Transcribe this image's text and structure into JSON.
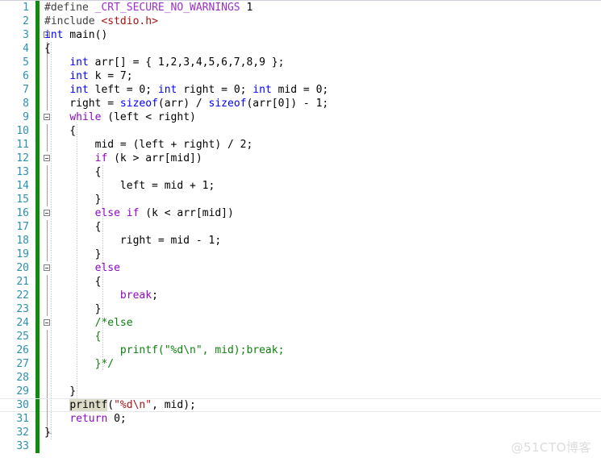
{
  "editor": {
    "language": "c",
    "total_lines": 33,
    "current_line": 30,
    "colors": {
      "background": "#ffffff",
      "line_number": "#2b91af",
      "change_bar": "#108b10",
      "keyword": "#0000ff",
      "control_keyword": "#8f08c4",
      "comment": "#108010",
      "string": "#a31515",
      "macro": "#9b30c9",
      "preprocessor": "#404040",
      "highlight": "#dbdbc8",
      "indent_guide": "#c8c8c8"
    }
  },
  "lines": [
    {
      "n": "1",
      "text": "#define _CRT_SECURE_NO_WARNINGS 1"
    },
    {
      "n": "2",
      "text": "#include <stdio.h>"
    },
    {
      "n": "3",
      "text": "int main()"
    },
    {
      "n": "4",
      "text": "{"
    },
    {
      "n": "5",
      "text": "    int arr[] = { 1,2,3,4,5,6,7,8,9 };"
    },
    {
      "n": "6",
      "text": "    int k = 7;"
    },
    {
      "n": "7",
      "text": "    int left = 0; int right = 0; int mid = 0;"
    },
    {
      "n": "8",
      "text": "    right = sizeof(arr) / sizeof(arr[0]) - 1;"
    },
    {
      "n": "9",
      "text": "    while (left < right)"
    },
    {
      "n": "10",
      "text": "    {"
    },
    {
      "n": "11",
      "text": "        mid = (left + right) / 2;"
    },
    {
      "n": "12",
      "text": "        if (k > arr[mid])"
    },
    {
      "n": "13",
      "text": "        {"
    },
    {
      "n": "14",
      "text": "            left = mid + 1;"
    },
    {
      "n": "15",
      "text": "        }"
    },
    {
      "n": "16",
      "text": "        else if (k < arr[mid])"
    },
    {
      "n": "17",
      "text": "        {"
    },
    {
      "n": "18",
      "text": "            right = mid - 1;"
    },
    {
      "n": "19",
      "text": "        }"
    },
    {
      "n": "20",
      "text": "        else"
    },
    {
      "n": "21",
      "text": "        {"
    },
    {
      "n": "22",
      "text": "            break;"
    },
    {
      "n": "23",
      "text": "        }"
    },
    {
      "n": "24",
      "text": "        /*else"
    },
    {
      "n": "25",
      "text": "        {"
    },
    {
      "n": "26",
      "text": "            printf(\"%d\\n\", mid);break;"
    },
    {
      "n": "27",
      "text": "        }*/"
    },
    {
      "n": "28",
      "text": ""
    },
    {
      "n": "29",
      "text": "    }"
    },
    {
      "n": "30",
      "text": "    printf(\"%d\\n\", mid);"
    },
    {
      "n": "31",
      "text": "    return 0;"
    },
    {
      "n": "32",
      "text": "}"
    },
    {
      "n": "33",
      "text": ""
    }
  ],
  "tokens": {
    "l1": [
      {
        "t": "#define ",
        "c": "pp"
      },
      {
        "t": "_CRT_SECURE_NO_WARNINGS",
        "c": "mac"
      },
      {
        "t": " 1",
        "c": "pl"
      }
    ],
    "l2": [
      {
        "t": "#include ",
        "c": "pp"
      },
      {
        "t": "<stdio.h>",
        "c": "inc"
      }
    ],
    "l3": [
      {
        "t": "int",
        "c": "k"
      },
      {
        "t": " main()",
        "c": "pl"
      }
    ],
    "l4": [
      {
        "t": "{",
        "c": "pl"
      }
    ],
    "l5": [
      {
        "t": "    ",
        "c": "pl"
      },
      {
        "t": "int",
        "c": "k"
      },
      {
        "t": " arr[] = { 1,2,3,4,5,6,7,8,9 };",
        "c": "pl"
      }
    ],
    "l6": [
      {
        "t": "    ",
        "c": "pl"
      },
      {
        "t": "int",
        "c": "k"
      },
      {
        "t": " k = 7;",
        "c": "pl"
      }
    ],
    "l7": [
      {
        "t": "    ",
        "c": "pl"
      },
      {
        "t": "int",
        "c": "k"
      },
      {
        "t": " left = 0; ",
        "c": "pl"
      },
      {
        "t": "int",
        "c": "k"
      },
      {
        "t": " right = 0; ",
        "c": "pl"
      },
      {
        "t": "int",
        "c": "k"
      },
      {
        "t": " mid = 0;",
        "c": "pl"
      }
    ],
    "l8": [
      {
        "t": "    right = ",
        "c": "pl"
      },
      {
        "t": "sizeof",
        "c": "k"
      },
      {
        "t": "(arr) / ",
        "c": "pl"
      },
      {
        "t": "sizeof",
        "c": "k"
      },
      {
        "t": "(arr[0]) - 1;",
        "c": "pl"
      }
    ],
    "l9": [
      {
        "t": "    ",
        "c": "pl"
      },
      {
        "t": "while",
        "c": "kc"
      },
      {
        "t": " (left < right)",
        "c": "pl"
      }
    ],
    "l10": [
      {
        "t": "    {",
        "c": "pl"
      }
    ],
    "l11": [
      {
        "t": "        mid = (left + right) / 2;",
        "c": "pl"
      }
    ],
    "l12": [
      {
        "t": "        ",
        "c": "pl"
      },
      {
        "t": "if",
        "c": "kc"
      },
      {
        "t": " (k > arr[mid])",
        "c": "pl"
      }
    ],
    "l13": [
      {
        "t": "        {",
        "c": "pl"
      }
    ],
    "l14": [
      {
        "t": "            left = mid + 1;",
        "c": "pl"
      }
    ],
    "l15": [
      {
        "t": "        }",
        "c": "pl"
      }
    ],
    "l16": [
      {
        "t": "        ",
        "c": "pl"
      },
      {
        "t": "else if",
        "c": "kc"
      },
      {
        "t": " (k < arr[mid])",
        "c": "pl"
      }
    ],
    "l17": [
      {
        "t": "        {",
        "c": "pl"
      }
    ],
    "l18": [
      {
        "t": "            right = mid - 1;",
        "c": "pl"
      }
    ],
    "l19": [
      {
        "t": "        }",
        "c": "pl"
      }
    ],
    "l20": [
      {
        "t": "        ",
        "c": "pl"
      },
      {
        "t": "else",
        "c": "kc"
      }
    ],
    "l21": [
      {
        "t": "        {",
        "c": "pl"
      }
    ],
    "l22": [
      {
        "t": "            ",
        "c": "pl"
      },
      {
        "t": "break",
        "c": "kc"
      },
      {
        "t": ";",
        "c": "pl"
      }
    ],
    "l23": [
      {
        "t": "        }",
        "c": "pl"
      }
    ],
    "l24": [
      {
        "t": "        ",
        "c": "pl"
      },
      {
        "t": "/*else",
        "c": "cm"
      }
    ],
    "l25": [
      {
        "t": "        ",
        "c": "pl"
      },
      {
        "t": "{",
        "c": "cm"
      }
    ],
    "l26": [
      {
        "t": "            ",
        "c": "pl"
      },
      {
        "t": "printf(\"%d\\n\", mid);break;",
        "c": "cm"
      }
    ],
    "l27": [
      {
        "t": "        ",
        "c": "pl"
      },
      {
        "t": "}*/",
        "c": "cm"
      }
    ],
    "l28": [],
    "l29": [
      {
        "t": "    }",
        "c": "pl"
      }
    ],
    "l30": [
      {
        "t": "    ",
        "c": "pl"
      },
      {
        "t": "printf",
        "c": "pl hl"
      },
      {
        "t": "(",
        "c": "pl"
      },
      {
        "t": "\"%d\\n\"",
        "c": "str"
      },
      {
        "t": ", mid);",
        "c": "pl"
      }
    ],
    "l31": [
      {
        "t": "    ",
        "c": "pl"
      },
      {
        "t": "return",
        "c": "kc"
      },
      {
        "t": " 0;",
        "c": "pl"
      }
    ],
    "l32": [
      {
        "t": "}",
        "c": "pl"
      }
    ],
    "l33": []
  },
  "fold_markers": [
    3,
    9,
    12,
    16,
    20,
    24
  ],
  "watermark": {
    "text": "@51CTO博客"
  }
}
